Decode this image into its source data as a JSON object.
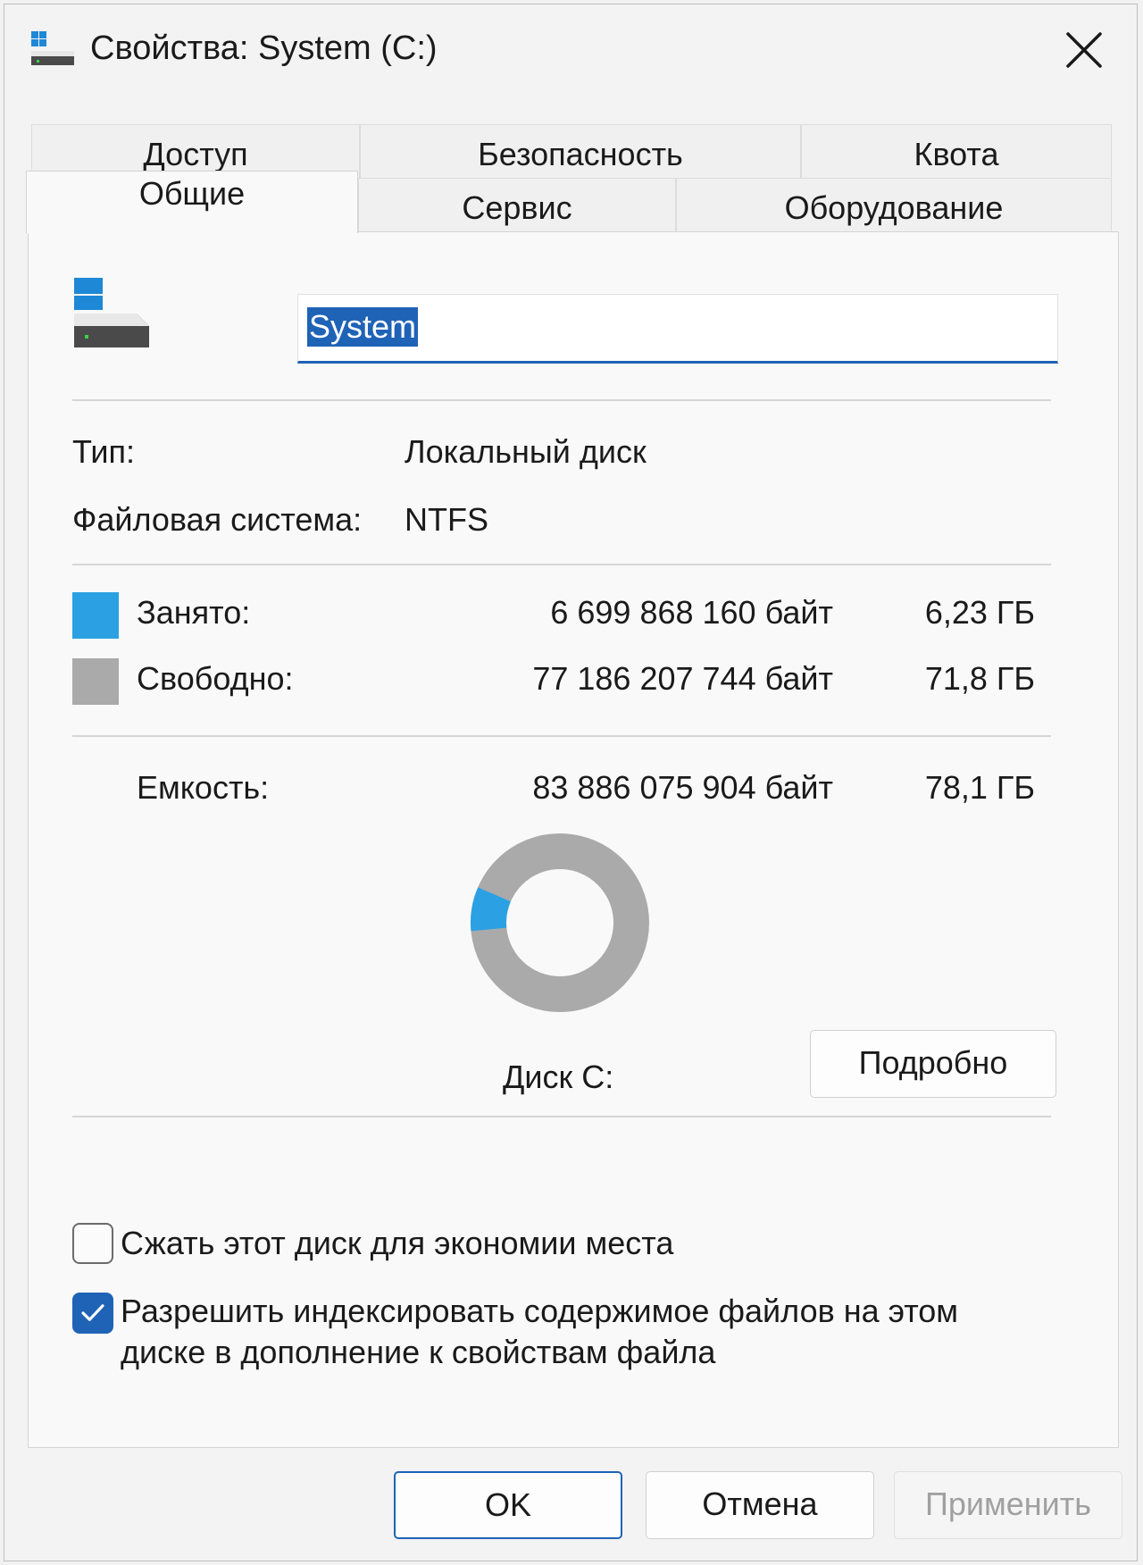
{
  "window": {
    "title": "Свойства: System (C:)"
  },
  "tabs": {
    "row1": [
      "Доступ",
      "Безопасность",
      "Квота"
    ],
    "row2": [
      "Общие",
      "Сервис",
      "Оборудование"
    ],
    "active": "Общие"
  },
  "general": {
    "drive_name": "System",
    "type_label": "Тип:",
    "type_value": "Локальный диск",
    "fs_label": "Файловая система:",
    "fs_value": "NTFS",
    "used": {
      "label": "Занято:",
      "bytes": "6 699 868 160 байт",
      "size": "6,23 ГБ",
      "color": "#2ba1e3"
    },
    "free": {
      "label": "Свободно:",
      "bytes": "77 186 207 744 байт",
      "size": "71,8 ГБ",
      "color": "#aaaaaa"
    },
    "capacity": {
      "label": "Емкость:",
      "bytes": "83 886 075 904 байт",
      "size": "78,1 ГБ"
    },
    "disk_label": "Диск C:",
    "details_button": "Подробно",
    "used_fraction": 0.0799
  },
  "options": {
    "compress": {
      "label": "Сжать этот диск для экономии места",
      "checked": false
    },
    "index": {
      "label_line1": "Разрешить индексировать содержимое файлов на этом",
      "label_line2": "диске в дополнение к свойствам файла",
      "checked": true
    }
  },
  "buttons": {
    "ok": "OK",
    "cancel": "Отмена",
    "apply": "Применить"
  },
  "icons": {
    "title": "drive-icon",
    "close": "close-icon",
    "check": "checkmark-icon"
  }
}
